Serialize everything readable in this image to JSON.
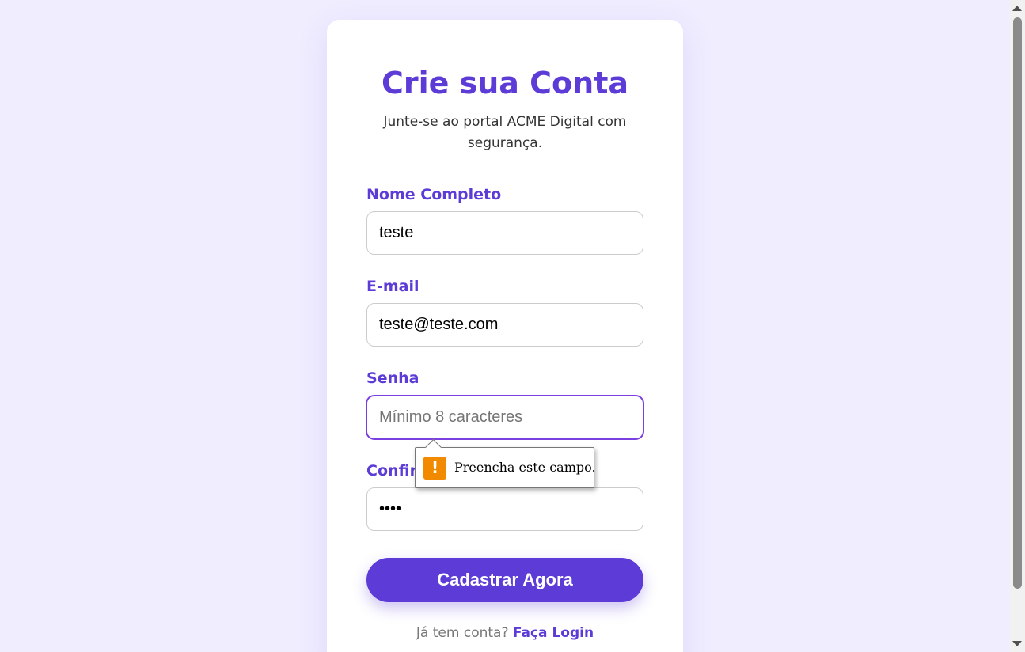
{
  "form": {
    "title": "Crie sua Conta",
    "subtitle": "Junte-se ao portal ACME Digital com segurança.",
    "fields": {
      "name": {
        "label": "Nome Completo",
        "value": "teste"
      },
      "email": {
        "label": "E-mail",
        "value": "teste@teste.com"
      },
      "password": {
        "label": "Senha",
        "value": "",
        "placeholder": "Mínimo 8 caracteres"
      },
      "confirm": {
        "label": "Confirmar Senha",
        "value": "••••"
      }
    },
    "submit_label": "Cadastrar Agora",
    "footer_text": "Já tem conta?",
    "footer_link": "Faça Login"
  },
  "validation_tooltip": {
    "icon": "warning-icon",
    "message": "Preencha este campo."
  },
  "colors": {
    "accent": "#5c3bd6",
    "background": "#f0edff",
    "warning": "#f28a00"
  }
}
